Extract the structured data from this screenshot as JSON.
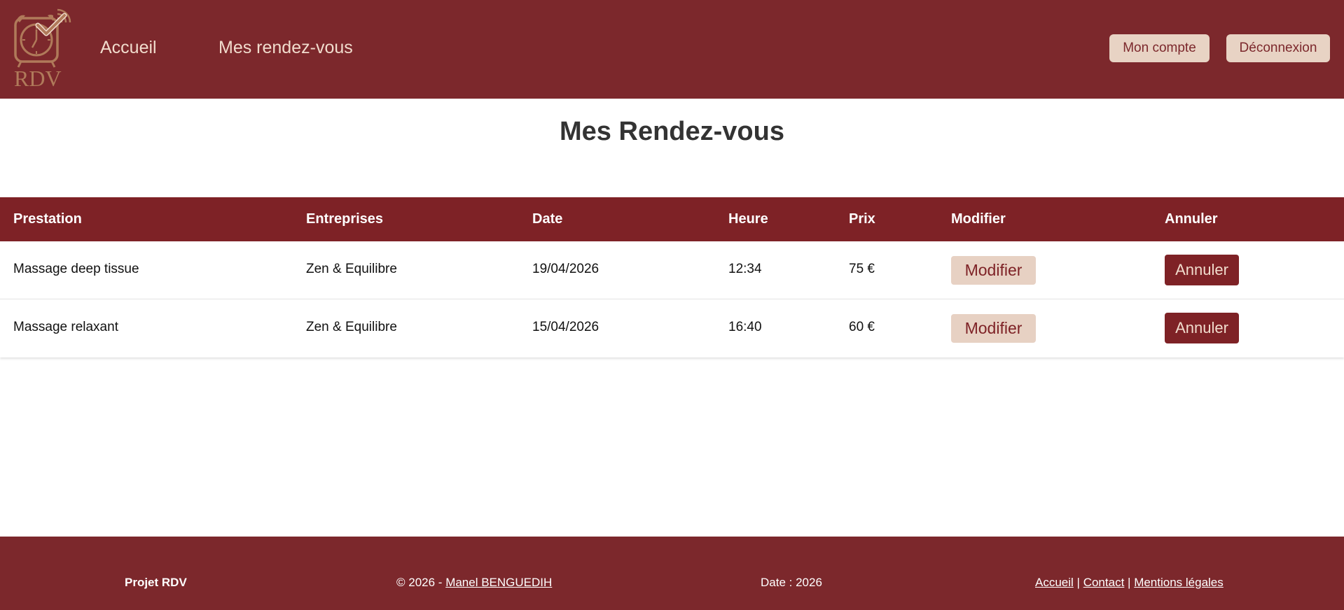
{
  "header": {
    "logo_text": "RDV",
    "nav": {
      "home": "Accueil",
      "appointments": "Mes rendez-vous"
    },
    "buttons": {
      "account": "Mon compte",
      "logout": "Déconnexion"
    },
    "colors": {
      "background": "#7c282c",
      "button_bg": "#e8d3c4",
      "logo": "#b07a5a"
    }
  },
  "main": {
    "title": "Mes Rendez-vous"
  },
  "table": {
    "columns": [
      "Prestation",
      "Entreprises",
      "Date",
      "Heure",
      "Prix",
      "Modifier",
      "Annuler"
    ],
    "rows": [
      {
        "prestation": "Massage deep tissue",
        "entreprise": "Zen & Equilibre",
        "date": "19/04/2026",
        "heure": "12:34",
        "prix": "75 €",
        "modify_label": "Modifier",
        "cancel_label": "Annuler"
      },
      {
        "prestation": "Massage relaxant",
        "entreprise": "Zen & Equilibre",
        "date": "15/04/2026",
        "heure": "16:40",
        "prix": "60 €",
        "modify_label": "Modifier",
        "cancel_label": "Annuler"
      }
    ],
    "colors": {
      "header_bg": "#7e2226",
      "modify_bg": "#e7d1c3",
      "cancel_bg": "#7e2226"
    }
  },
  "footer": {
    "project": "Projet RDV",
    "copyright_prefix": "© 2026 - ",
    "author": "Manel BENGUEDIH",
    "date": "Date : 2026",
    "links": {
      "home": "Accueil",
      "separator": "|",
      "contact": "Contact",
      "legal": "Mentions légales"
    }
  },
  "icons": {
    "logo": "alarm-clock-checkmark-icon"
  }
}
